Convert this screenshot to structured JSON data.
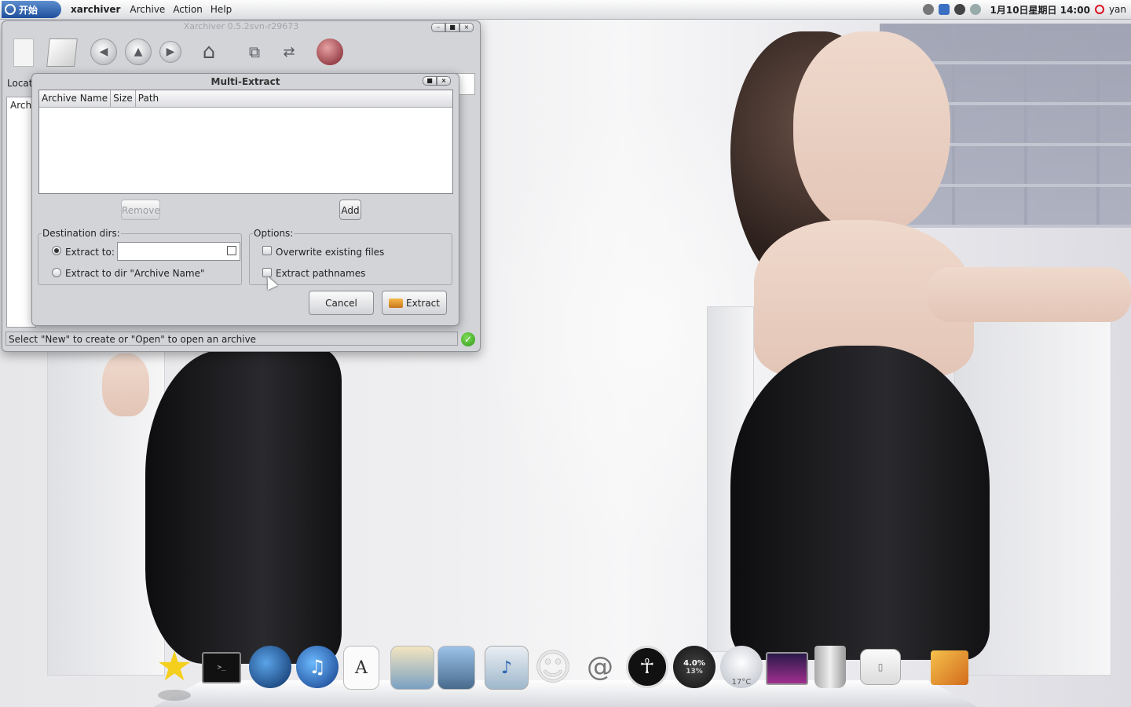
{
  "top_panel": {
    "start_label": "开始",
    "app_name": "xarchiver",
    "menus": [
      "Archive",
      "Action",
      "Help"
    ],
    "clock": "1月10日星期日 14:00",
    "user": "yan",
    "tray_icons": [
      "network-icon",
      "wifi-icon",
      "shield-icon",
      "weather-icon"
    ]
  },
  "xarchiver": {
    "title": "Xarchiver 0.5.2svn-r29673",
    "location_label": "Locat",
    "archive_header": "Archi",
    "status": "Select \"New\" to create or \"Open\" to open an archive",
    "toolbar": [
      "new-icon",
      "open-icon",
      "back-icon",
      "up-icon",
      "forward-icon",
      "home-icon",
      "add-icon",
      "extract-icon",
      "stop-icon"
    ]
  },
  "multi_extract": {
    "title": "Multi-Extract",
    "columns": [
      "Archive Name",
      "Size",
      "Path"
    ],
    "remove_label": "Remove",
    "add_label": "Add",
    "destination_label": "Destination dirs:",
    "extract_to_label": "Extract to:",
    "extract_to_value": "",
    "extract_to_dir_label": "Extract to dir \"Archive Name\"",
    "options_label": "Options:",
    "overwrite_label": "Overwrite existing files",
    "pathnames_label": "Extract pathnames",
    "cancel_label": "Cancel",
    "extract_label": "Extract"
  },
  "dock": {
    "items": [
      "star-icon",
      "terminal-icon",
      "browser-icon",
      "itunes-icon",
      "text-editor-icon",
      "image-viewer-icon",
      "photo-icon",
      "music-icon",
      "aim-icon",
      "mail-icon",
      "accessibility-icon",
      "cpu-monitor-icon",
      "weather-icon",
      "screen-icon",
      "trash-icon",
      "switch-icon",
      "package-icon"
    ],
    "cpu_value": "4.0%",
    "cpu_sub": "13%",
    "weather_temp": "17°C"
  }
}
